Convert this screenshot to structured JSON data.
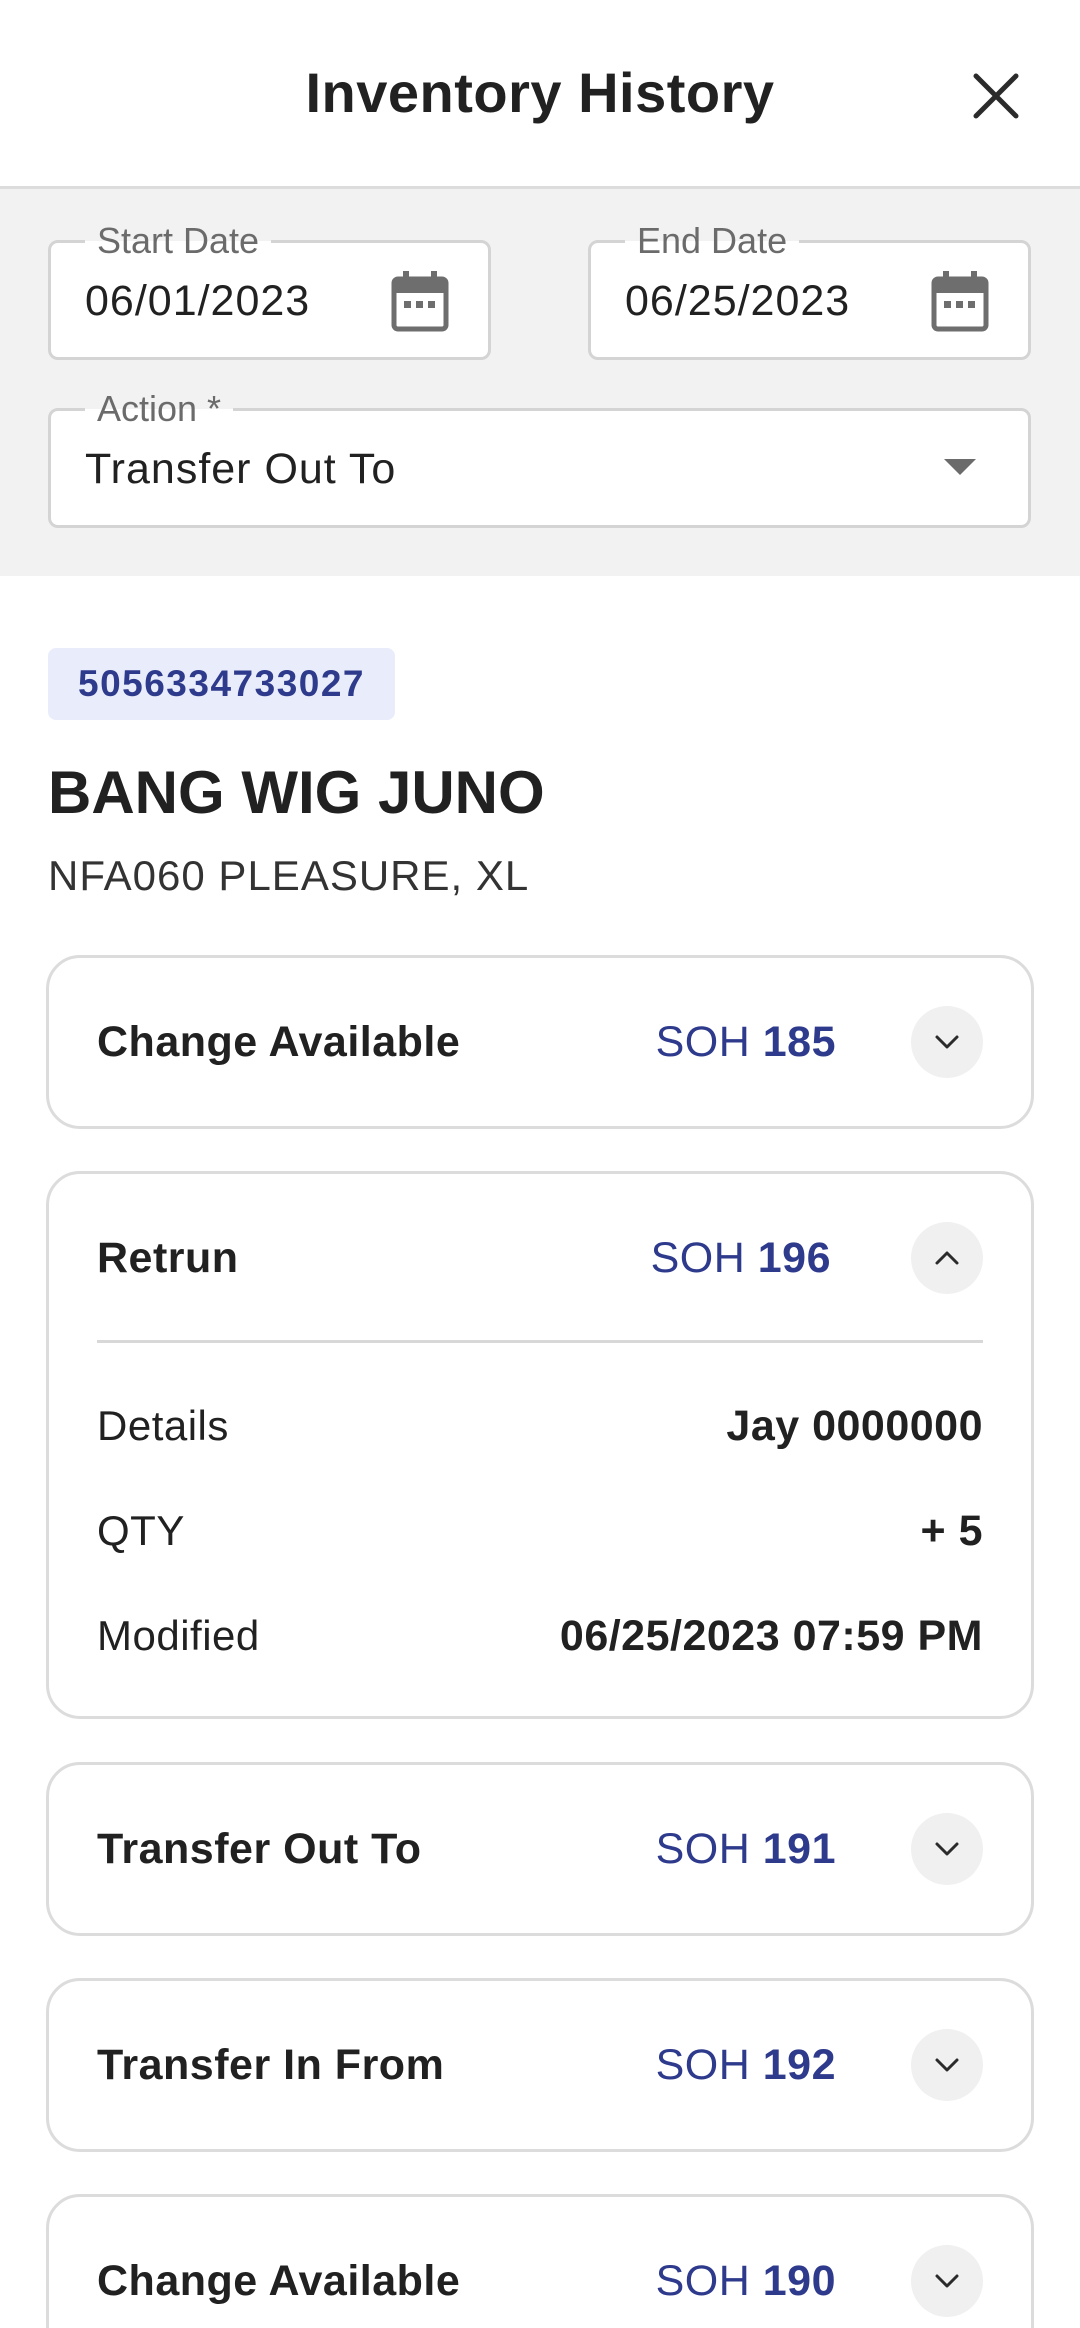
{
  "header": {
    "title": "Inventory History"
  },
  "filters": {
    "start_date": {
      "label": "Start Date",
      "value": "06/01/2023"
    },
    "separator": "-",
    "end_date": {
      "label": "End Date",
      "value": "06/25/2023"
    },
    "action": {
      "label": "Action *",
      "value": "Transfer Out To"
    }
  },
  "product": {
    "barcode": "5056334733027",
    "name": "BANG WIG JUNO",
    "subtitle": "NFA060 PLEASURE, XL"
  },
  "soh_label": "SOH",
  "history": [
    {
      "title": "Change Available",
      "soh": "185",
      "expanded": false
    },
    {
      "title": "Retrun",
      "soh": "196",
      "expanded": true,
      "details": [
        {
          "label": "Details",
          "value": "Jay 0000000"
        },
        {
          "label": "QTY",
          "value": "+ 5"
        },
        {
          "label": "Modified",
          "value": "06/25/2023 07:59 PM"
        }
      ]
    },
    {
      "title": "Transfer Out To",
      "soh": "191",
      "expanded": false
    },
    {
      "title": "Transfer In From",
      "soh": "192",
      "expanded": false
    },
    {
      "title": "Change Available",
      "soh": "190",
      "expanded": false
    }
  ],
  "icons": {
    "close": "close-icon",
    "calendar": "calendar-icon",
    "dropdown": "caret-down-icon",
    "chevron_down": "chevron-down-icon",
    "chevron_up": "chevron-up-icon"
  },
  "colors": {
    "accent": "#2e3a8c",
    "barcode_bg": "#e9edfb",
    "filter_bg": "#f2f2f2"
  }
}
